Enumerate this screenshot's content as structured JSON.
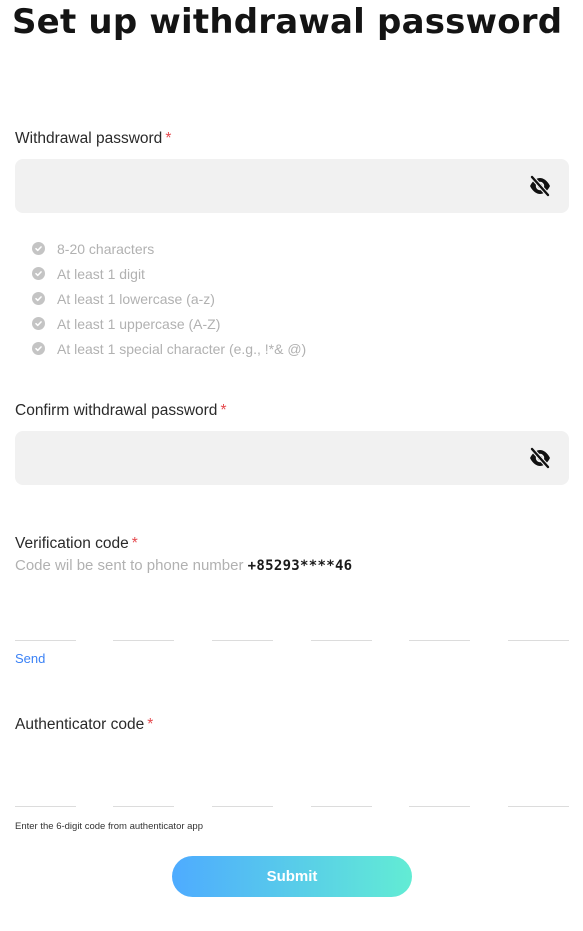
{
  "page": {
    "title": "Set up withdrawal password"
  },
  "withdrawal_password": {
    "label": "Withdrawal password",
    "required_mark": "*",
    "value": "",
    "toggle_icon": "eye-off-icon"
  },
  "password_rules": [
    {
      "text": "8-20 characters",
      "icon": "check-circle-icon"
    },
    {
      "text": "At least 1 digit",
      "icon": "check-circle-icon"
    },
    {
      "text": "At least 1 lowercase (a-z)",
      "icon": "check-circle-icon"
    },
    {
      "text": "At least 1 uppercase (A-Z)",
      "icon": "check-circle-icon"
    },
    {
      "text": "At least 1 special character (e.g., !*& @)",
      "icon": "check-circle-icon"
    }
  ],
  "confirm_password": {
    "label": "Confirm withdrawal password",
    "required_mark": "*",
    "value": "",
    "toggle_icon": "eye-off-icon"
  },
  "verification": {
    "label": "Verification code",
    "required_mark": "*",
    "hint_prefix": "Code wil be sent to phone number",
    "phone": "+85293****46",
    "digits": [
      "",
      "",
      "",
      "",
      "",
      ""
    ],
    "send_label": "Send"
  },
  "authenticator": {
    "label": "Authenticator code",
    "required_mark": "*",
    "digits": [
      "",
      "",
      "",
      "",
      "",
      ""
    ],
    "hint": "Enter the 6-digit code from authenticator app"
  },
  "submit": {
    "label": "Submit"
  },
  "colors": {
    "required": "#e5484d",
    "link": "#3b82f6",
    "button_gradient_start": "#4eabff",
    "button_gradient_end": "#62ecd4",
    "input_background": "#f1f1f1"
  }
}
